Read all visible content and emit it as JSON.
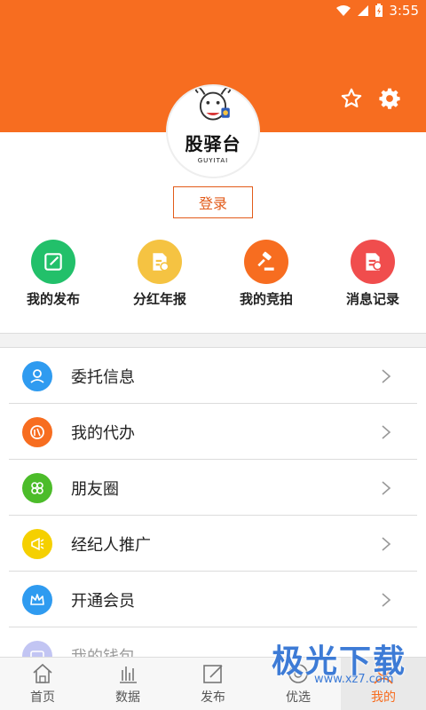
{
  "status_bar": {
    "time": "3:55"
  },
  "profile": {
    "brand_name": "股驿台",
    "brand_sub": "GUYITAI",
    "login_label": "登录"
  },
  "quick_actions": [
    {
      "label": "我的发布",
      "icon": "edit-icon",
      "color": "#22c06a"
    },
    {
      "label": "分红年报",
      "icon": "report-icon",
      "color": "#f5c342"
    },
    {
      "label": "我的竞拍",
      "icon": "gavel-icon",
      "color": "#f76d20"
    },
    {
      "label": "消息记录",
      "icon": "message-record-icon",
      "color": "#f04d4d"
    }
  ],
  "menu": [
    {
      "label": "委托信息",
      "icon": "user-hand-icon",
      "color": "#2f9bf0"
    },
    {
      "label": "我的代办",
      "icon": "agency-icon",
      "color": "#f76d20"
    },
    {
      "label": "朋友圈",
      "icon": "friends-icon",
      "color": "#4cbc2a"
    },
    {
      "label": "经纪人推广",
      "icon": "megaphone-icon",
      "color": "#f5d000"
    },
    {
      "label": "开通会员",
      "icon": "crown-icon",
      "color": "#2f9bf0"
    },
    {
      "label": "我的钱包",
      "icon": "wallet-icon",
      "color": "#7a7fe6"
    }
  ],
  "tabs": [
    {
      "label": "首页",
      "icon": "home-icon",
      "active": false
    },
    {
      "label": "数据",
      "icon": "bar-chart-icon",
      "active": false
    },
    {
      "label": "发布",
      "icon": "compose-icon",
      "active": false
    },
    {
      "label": "优选",
      "icon": "select-icon",
      "active": false
    },
    {
      "label": "我的",
      "icon": "profile-icon",
      "active": true
    }
  ],
  "watermark": {
    "text": "极光下载",
    "url": "www.xz7.com"
  },
  "colors": {
    "primary": "#f76d20",
    "text": "#222222"
  }
}
